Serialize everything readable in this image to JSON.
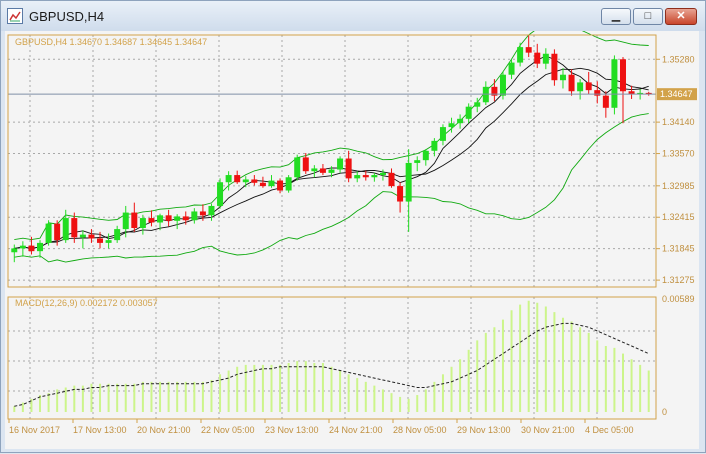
{
  "window": {
    "title": "GBPUSD,H4",
    "minimize_glyph": "▁",
    "maximize_glyph": "□",
    "close_glyph": "✕"
  },
  "main_header": "GBPUSD,H4  1.34670 1.34687 1.34645 1.34647",
  "macd_header": "MACD(12,26,9) 0.002172 0.003057",
  "price_axis": {
    "ticks": [
      "1.35280",
      "1.34140",
      "1.33570",
      "1.32985",
      "1.32415",
      "1.31845",
      "1.31275"
    ],
    "current_price": "1.34647"
  },
  "macd_axis": {
    "ticks": [
      "0.00589",
      "0"
    ]
  },
  "time_axis": [
    "16 Nov 2017",
    "17 Nov 13:00",
    "20 Nov 21:00",
    "22 Nov 05:00",
    "23 Nov 13:00",
    "24 Nov 21:00",
    "28 Nov 05:00",
    "29 Nov 13:00",
    "30 Nov 21:00",
    "4 Dec 05:00"
  ],
  "colors": {
    "bull": "#22dd22",
    "bear": "#ee1111",
    "axis": "#d2a24a",
    "bands": "#11aa11",
    "ma": "#111111",
    "macd_hist": "#ccf58a",
    "macd_signal": "#222222"
  },
  "chart_data": {
    "type": "candlestick",
    "symbol": "GBPUSD",
    "timeframe": "H4",
    "ylim": [
      1.3115,
      1.3572
    ],
    "candles": [
      [
        1.3178,
        1.3192,
        1.316,
        1.3185
      ],
      [
        1.3185,
        1.3198,
        1.317,
        1.319
      ],
      [
        1.319,
        1.3206,
        1.3174,
        1.318
      ],
      [
        1.318,
        1.32,
        1.3168,
        1.3195
      ],
      [
        1.3195,
        1.3236,
        1.319,
        1.323
      ],
      [
        1.323,
        1.3236,
        1.319,
        1.32
      ],
      [
        1.32,
        1.3255,
        1.3195,
        1.324
      ],
      [
        1.324,
        1.325,
        1.3195,
        1.3205
      ],
      [
        1.3205,
        1.3218,
        1.3185,
        1.321
      ],
      [
        1.321,
        1.322,
        1.3195,
        1.3203
      ],
      [
        1.3203,
        1.3215,
        1.3185,
        1.3195
      ],
      [
        1.3195,
        1.3212,
        1.3185,
        1.32
      ],
      [
        1.32,
        1.3226,
        1.3195,
        1.322
      ],
      [
        1.322,
        1.3262,
        1.3205,
        1.325
      ],
      [
        1.325,
        1.3268,
        1.3215,
        1.3222
      ],
      [
        1.3222,
        1.3246,
        1.321,
        1.324
      ],
      [
        1.324,
        1.3254,
        1.3225,
        1.3232
      ],
      [
        1.3232,
        1.3248,
        1.3218,
        1.3245
      ],
      [
        1.3245,
        1.3255,
        1.3225,
        1.3235
      ],
      [
        1.3235,
        1.3247,
        1.322,
        1.3243
      ],
      [
        1.3243,
        1.3252,
        1.3228,
        1.3236
      ],
      [
        1.3236,
        1.3258,
        1.323,
        1.3252
      ],
      [
        1.3252,
        1.3265,
        1.3235,
        1.3245
      ],
      [
        1.3245,
        1.3266,
        1.3235,
        1.3262
      ],
      [
        1.3262,
        1.3312,
        1.3257,
        1.3305
      ],
      [
        1.3305,
        1.3325,
        1.329,
        1.3318
      ],
      [
        1.3318,
        1.3326,
        1.3302,
        1.3305
      ],
      [
        1.3305,
        1.3316,
        1.3296,
        1.331
      ],
      [
        1.331,
        1.3318,
        1.3299,
        1.3304
      ],
      [
        1.3304,
        1.3315,
        1.3295,
        1.3298
      ],
      [
        1.3298,
        1.3318,
        1.3295,
        1.3308
      ],
      [
        1.3308,
        1.3312,
        1.3285,
        1.329
      ],
      [
        1.329,
        1.3318,
        1.3286,
        1.3314
      ],
      [
        1.3314,
        1.3355,
        1.3308,
        1.335
      ],
      [
        1.335,
        1.3358,
        1.332,
        1.3325
      ],
      [
        1.3325,
        1.3336,
        1.3314,
        1.333
      ],
      [
        1.333,
        1.3338,
        1.3318,
        1.3322
      ],
      [
        1.3322,
        1.3334,
        1.3314,
        1.3328
      ],
      [
        1.3328,
        1.3352,
        1.3322,
        1.3348
      ],
      [
        1.3348,
        1.3362,
        1.3305,
        1.3312
      ],
      [
        1.3312,
        1.3325,
        1.3305,
        1.3318
      ],
      [
        1.3318,
        1.3326,
        1.3308,
        1.3314
      ],
      [
        1.3314,
        1.3322,
        1.3306,
        1.3318
      ],
      [
        1.3318,
        1.3328,
        1.3308,
        1.3322
      ],
      [
        1.3322,
        1.333,
        1.3295,
        1.3298
      ],
      [
        1.3298,
        1.3305,
        1.325,
        1.327
      ],
      [
        1.327,
        1.3365,
        1.3215,
        1.334
      ],
      [
        1.334,
        1.3352,
        1.3325,
        1.3345
      ],
      [
        1.3345,
        1.3365,
        1.3335,
        1.3362
      ],
      [
        1.3362,
        1.3385,
        1.3352,
        1.338
      ],
      [
        1.338,
        1.341,
        1.3372,
        1.3405
      ],
      [
        1.3405,
        1.3422,
        1.3395,
        1.3412
      ],
      [
        1.3412,
        1.3428,
        1.3402,
        1.342
      ],
      [
        1.342,
        1.3448,
        1.3412,
        1.3442
      ],
      [
        1.3442,
        1.3458,
        1.3432,
        1.345
      ],
      [
        1.345,
        1.3488,
        1.3445,
        1.3478
      ],
      [
        1.3478,
        1.3492,
        1.3452,
        1.3462
      ],
      [
        1.3462,
        1.3506,
        1.3455,
        1.35
      ],
      [
        1.35,
        1.3528,
        1.3492,
        1.3522
      ],
      [
        1.3522,
        1.3558,
        1.3515,
        1.355
      ],
      [
        1.355,
        1.3572,
        1.3532,
        1.354
      ],
      [
        1.354,
        1.3556,
        1.3512,
        1.352
      ],
      [
        1.352,
        1.3548,
        1.351,
        1.3538
      ],
      [
        1.3538,
        1.3546,
        1.348,
        1.349
      ],
      [
        1.349,
        1.3512,
        1.3475,
        1.35
      ],
      [
        1.35,
        1.351,
        1.3462,
        1.347
      ],
      [
        1.347,
        1.3492,
        1.3455,
        1.3486
      ],
      [
        1.3486,
        1.3505,
        1.3465,
        1.3472
      ],
      [
        1.3472,
        1.3488,
        1.3448,
        1.3462
      ],
      [
        1.3462,
        1.347,
        1.3422,
        1.344
      ],
      [
        1.344,
        1.3535,
        1.3428,
        1.3528
      ],
      [
        1.3528,
        1.3532,
        1.3412,
        1.347
      ],
      [
        1.347,
        1.348,
        1.3456,
        1.3465
      ],
      [
        1.3465,
        1.3474,
        1.3455,
        1.3467
      ],
      [
        1.3467,
        1.3469,
        1.3462,
        1.3465
      ]
    ],
    "macd_histogram": [
      0.0003,
      0.0005,
      0.0007,
      0.0009,
      0.001,
      0.0012,
      0.0013,
      0.0014,
      0.0014,
      0.0015,
      0.0015,
      0.0015,
      0.0015,
      0.0015,
      0.0015,
      0.0016,
      0.0016,
      0.0016,
      0.0016,
      0.0016,
      0.0016,
      0.0016,
      0.0016,
      0.0017,
      0.002,
      0.0022,
      0.0024,
      0.0025,
      0.0025,
      0.0025,
      0.0025,
      0.0025,
      0.0026,
      0.0027,
      0.0027,
      0.0026,
      0.0026,
      0.0024,
      0.0022,
      0.002,
      0.0018,
      0.0016,
      0.0014,
      0.0012,
      0.001,
      0.0008,
      0.0007,
      0.0009,
      0.0012,
      0.0016,
      0.002,
      0.0024,
      0.0028,
      0.0033,
      0.0038,
      0.0042,
      0.0045,
      0.0049,
      0.0054,
      0.0057,
      0.0059,
      0.0058,
      0.0056,
      0.0053,
      0.005,
      0.0048,
      0.0045,
      0.0042,
      0.0038,
      0.0035,
      0.0034,
      0.0031,
      0.0028,
      0.0025,
      0.0022
    ],
    "macd_signal": [
      0.0003,
      0.0004,
      0.0006,
      0.0008,
      0.0009,
      0.001,
      0.0011,
      0.0012,
      0.0012,
      0.0013,
      0.0013,
      0.0014,
      0.0014,
      0.0014,
      0.0014,
      0.0015,
      0.0015,
      0.0015,
      0.0015,
      0.0015,
      0.0015,
      0.0015,
      0.0015,
      0.0016,
      0.0017,
      0.0018,
      0.002,
      0.0021,
      0.0022,
      0.0023,
      0.0023,
      0.0024,
      0.0024,
      0.0024,
      0.0024,
      0.0024,
      0.0024,
      0.0023,
      0.0022,
      0.0021,
      0.002,
      0.0019,
      0.0018,
      0.0017,
      0.0016,
      0.0015,
      0.0014,
      0.0013,
      0.0013,
      0.0014,
      0.0015,
      0.0016,
      0.0018,
      0.002,
      0.0022,
      0.0025,
      0.0028,
      0.0031,
      0.0034,
      0.0037,
      0.004,
      0.0043,
      0.0045,
      0.0046,
      0.0047,
      0.0047,
      0.0046,
      0.0045,
      0.0043,
      0.0041,
      0.0039,
      0.0037,
      0.0035,
      0.0033,
      0.0031
    ],
    "macd_ylim": [
      0,
      0.00589
    ]
  }
}
